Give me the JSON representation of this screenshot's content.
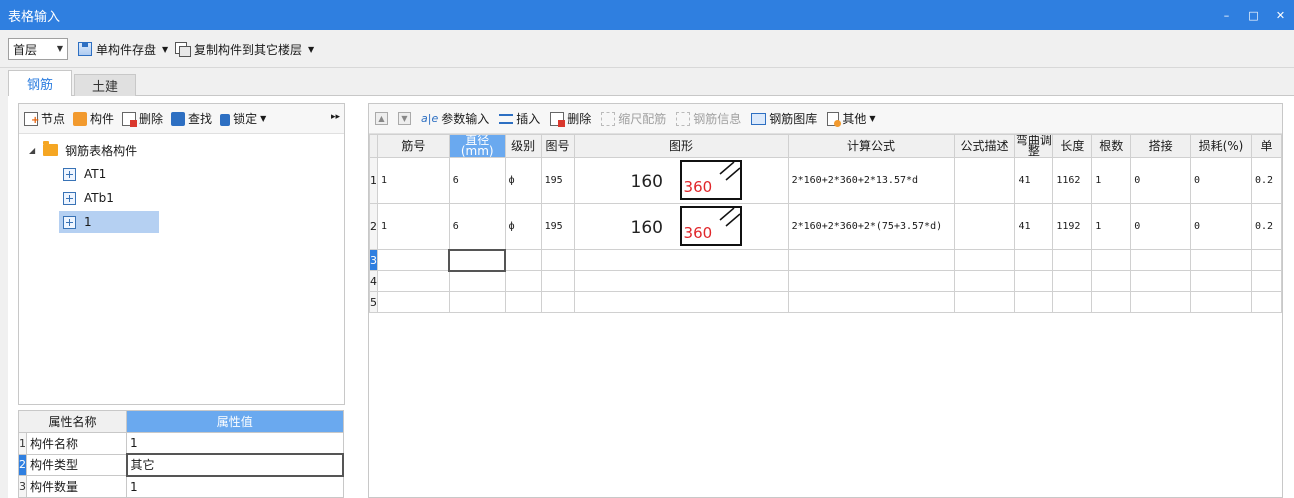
{
  "window": {
    "title": "表格输入",
    "min_glyph": "–",
    "max_glyph": "□",
    "close_glyph": "✕"
  },
  "toolbar": {
    "floor_value": "首层",
    "save_label": "单构件存盘",
    "copy_label": "复制构件到其它楼层"
  },
  "tabs": [
    {
      "label": "钢筋",
      "active": true
    },
    {
      "label": "土建",
      "active": false
    }
  ],
  "left_toolbar": {
    "node": "节点",
    "component": "构件",
    "delete": "删除",
    "find": "查找",
    "lock": "锁定",
    "more": "▸▸"
  },
  "tree": {
    "root": "钢筋表格构件",
    "children": [
      "AT1",
      "ATb1",
      "1"
    ],
    "selected_index": 2
  },
  "properties": {
    "header_name": "属性名称",
    "header_value": "属性值",
    "rows": [
      {
        "idx": "1",
        "name": "构件名称",
        "value": "1"
      },
      {
        "idx": "2",
        "name": "构件类型",
        "value": "其它"
      },
      {
        "idx": "3",
        "name": "构件数量",
        "value": "1"
      }
    ]
  },
  "right_toolbar": {
    "param_input": "参数输入",
    "insert": "插入",
    "delete": "删除",
    "scale": "缩尺配筋",
    "rebar_info": "钢筋信息",
    "rebar_lib": "钢筋图库",
    "other": "其他"
  },
  "grid": {
    "headers": [
      "筋号",
      "直径(mm)",
      "级别",
      "图号",
      "图形",
      "计算公式",
      "公式描述",
      "弯曲调整",
      "长度",
      "根数",
      "搭接",
      "损耗(%)",
      "单"
    ],
    "rows": [
      {
        "rn": "1",
        "jin": "1",
        "dia": "6",
        "grade": "ф",
        "fig": "195",
        "shape_left": "160",
        "shape_right": "360",
        "formula": "2*160+2*360+2*13.57*d",
        "desc": "",
        "bend": "41",
        "len": "1162",
        "count": "1",
        "lap": "0",
        "loss": "0",
        "unit": "0.2"
      },
      {
        "rn": "2",
        "jin": "1",
        "dia": "6",
        "grade": "ф",
        "fig": "195",
        "shape_left": "160",
        "shape_right": "360",
        "formula": "2*160+2*360+2*(75+3.57*d)",
        "desc": "",
        "bend": "41",
        "len": "1192",
        "count": "1",
        "lap": "0",
        "loss": "0",
        "unit": "0.2"
      }
    ],
    "empty_rows": [
      "3",
      "4",
      "5"
    ]
  }
}
